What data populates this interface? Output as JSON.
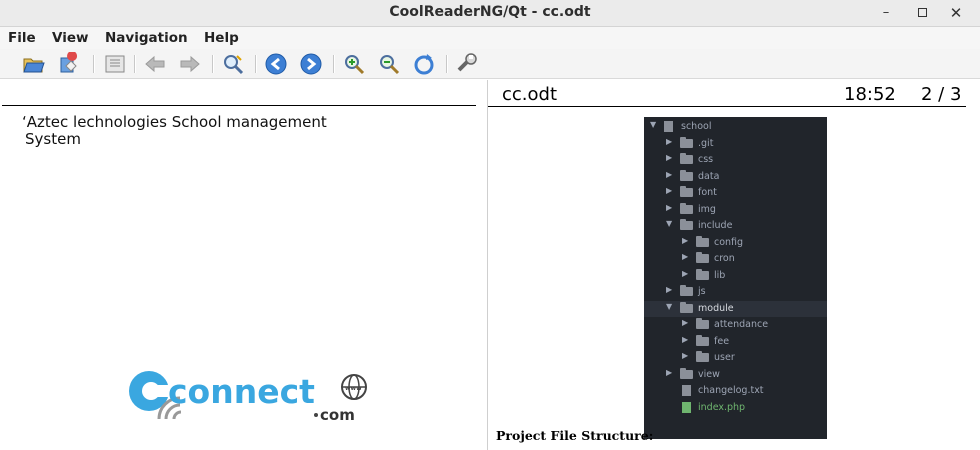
{
  "window": {
    "title": "CoolReaderNG/Qt - cc.odt",
    "controls": [
      "minimize",
      "maximize",
      "close"
    ]
  },
  "menu": [
    "File",
    "View",
    "Navigation",
    "Help"
  ],
  "toolbar": {
    "icons": [
      "open-file-icon",
      "recent-books-icon",
      "book-table-of-contents-icon",
      "back-arrow-icon",
      "forward-arrow-icon",
      "find-icon",
      "previous-page-icon",
      "next-page-icon",
      "zoom-in-icon",
      "zoom-out-icon",
      "rotate-icon",
      "settings-icon"
    ]
  },
  "left_page": {
    "text_line1": "‘Aztec lechnologies School management",
    "text_line2": "System",
    "logo": {
      "word": "connect",
      "suffix": "com",
      "www": "www"
    }
  },
  "right_page": {
    "filename": "cc.odt",
    "time": "18:52",
    "page": "2 / 3",
    "caption": "Project File Structure:",
    "tree": {
      "root": "school",
      "nodes": [
        {
          "label": ".git",
          "type": "folder",
          "depth": 1,
          "open": false
        },
        {
          "label": "css",
          "type": "folder",
          "depth": 1,
          "open": false
        },
        {
          "label": "data",
          "type": "folder",
          "depth": 1,
          "open": false
        },
        {
          "label": "font",
          "type": "folder",
          "depth": 1,
          "open": false
        },
        {
          "label": "img",
          "type": "folder",
          "depth": 1,
          "open": false
        },
        {
          "label": "include",
          "type": "folder",
          "depth": 1,
          "open": true
        },
        {
          "label": "config",
          "type": "folder",
          "depth": 2,
          "open": false
        },
        {
          "label": "cron",
          "type": "folder",
          "depth": 2,
          "open": false
        },
        {
          "label": "lib",
          "type": "folder",
          "depth": 2,
          "open": false
        },
        {
          "label": "js",
          "type": "folder",
          "depth": 1,
          "open": false
        },
        {
          "label": "module",
          "type": "folder",
          "depth": 1,
          "open": true,
          "selected": true
        },
        {
          "label": "attendance",
          "type": "folder",
          "depth": 2,
          "open": false
        },
        {
          "label": "fee",
          "type": "folder",
          "depth": 2,
          "open": false
        },
        {
          "label": "user",
          "type": "folder",
          "depth": 2,
          "open": false
        },
        {
          "label": "view",
          "type": "folder",
          "depth": 1,
          "open": false
        },
        {
          "label": "changelog.txt",
          "type": "file",
          "depth": 1
        },
        {
          "label": "index.php",
          "type": "file-green",
          "depth": 1
        }
      ]
    }
  }
}
